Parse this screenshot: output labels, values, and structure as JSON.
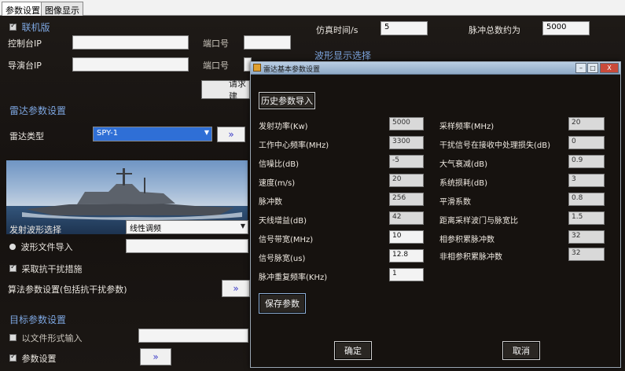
{
  "tabs": [
    "参数设置",
    "图像显示"
  ],
  "online": {
    "label": "联机版"
  },
  "controller_ip": {
    "label": "控制台IP",
    "value": ""
  },
  "director_ip": {
    "label": "导演台IP",
    "value": ""
  },
  "port1": {
    "label": "端口号",
    "value": ""
  },
  "port2": {
    "label": "端口号",
    "value": ""
  },
  "request_button": "请求建",
  "sim_time": {
    "label": "仿真时间/s",
    "value": "5"
  },
  "pulse_total": {
    "label": "脉冲总数约为",
    "value": "5000"
  },
  "waveform_display": {
    "label": "波形显示选择"
  },
  "radar_section": "雷达参数设置",
  "radar_type": {
    "label": "雷达类型",
    "value": "SPY-1"
  },
  "chevron": "»",
  "waveform_select": {
    "label": "发射波形选择",
    "value": "线性调频"
  },
  "waveform_file": {
    "label": "波形文件导入",
    "value": ""
  },
  "anti_jam": {
    "label": "采取抗干扰措施"
  },
  "algo_params": {
    "label": "算法参数设置(包括抗干扰参数)"
  },
  "target_section": "目标参数设置",
  "file_import": {
    "label": "以文件形式输入",
    "value": ""
  },
  "param_set": {
    "label": "参数设置"
  },
  "dialog": {
    "title": "雷达基本参数设置",
    "close": "X",
    "history_import": "历史参数导入",
    "save": "保存参数",
    "ok": "确定",
    "cancel": "取消",
    "left_fields": [
      {
        "label": "发射功率(Kw)",
        "value": "5000"
      },
      {
        "label": "工作中心频率(MHz)",
        "value": "3300"
      },
      {
        "label": "信噪比(dB)",
        "value": "-5"
      },
      {
        "label": "速度(m/s)",
        "value": "20"
      },
      {
        "label": "脉冲数",
        "value": "256"
      },
      {
        "label": "天线增益(dB)",
        "value": "42"
      },
      {
        "label": "信号带宽(MHz)",
        "value": "10"
      },
      {
        "label": "信号脉宽(us)",
        "value": "12.8"
      },
      {
        "label": "脉冲重复频率(KHz)",
        "value": "1"
      }
    ],
    "right_fields": [
      {
        "label": "采样频率(MHz)",
        "value": "20"
      },
      {
        "label": "干扰信号在接收中处理损失(dB)",
        "value": "0"
      },
      {
        "label": "大气衰减(dB)",
        "value": "0.9"
      },
      {
        "label": "系统损耗(dB)",
        "value": "3"
      },
      {
        "label": "平滑系数",
        "value": "0.8"
      },
      {
        "label": "距离采样波门与脉宽比",
        "value": "1.5"
      },
      {
        "label": "相参积累脉冲数",
        "value": "32"
      },
      {
        "label": "非相参积累脉冲数",
        "value": "32"
      }
    ]
  }
}
